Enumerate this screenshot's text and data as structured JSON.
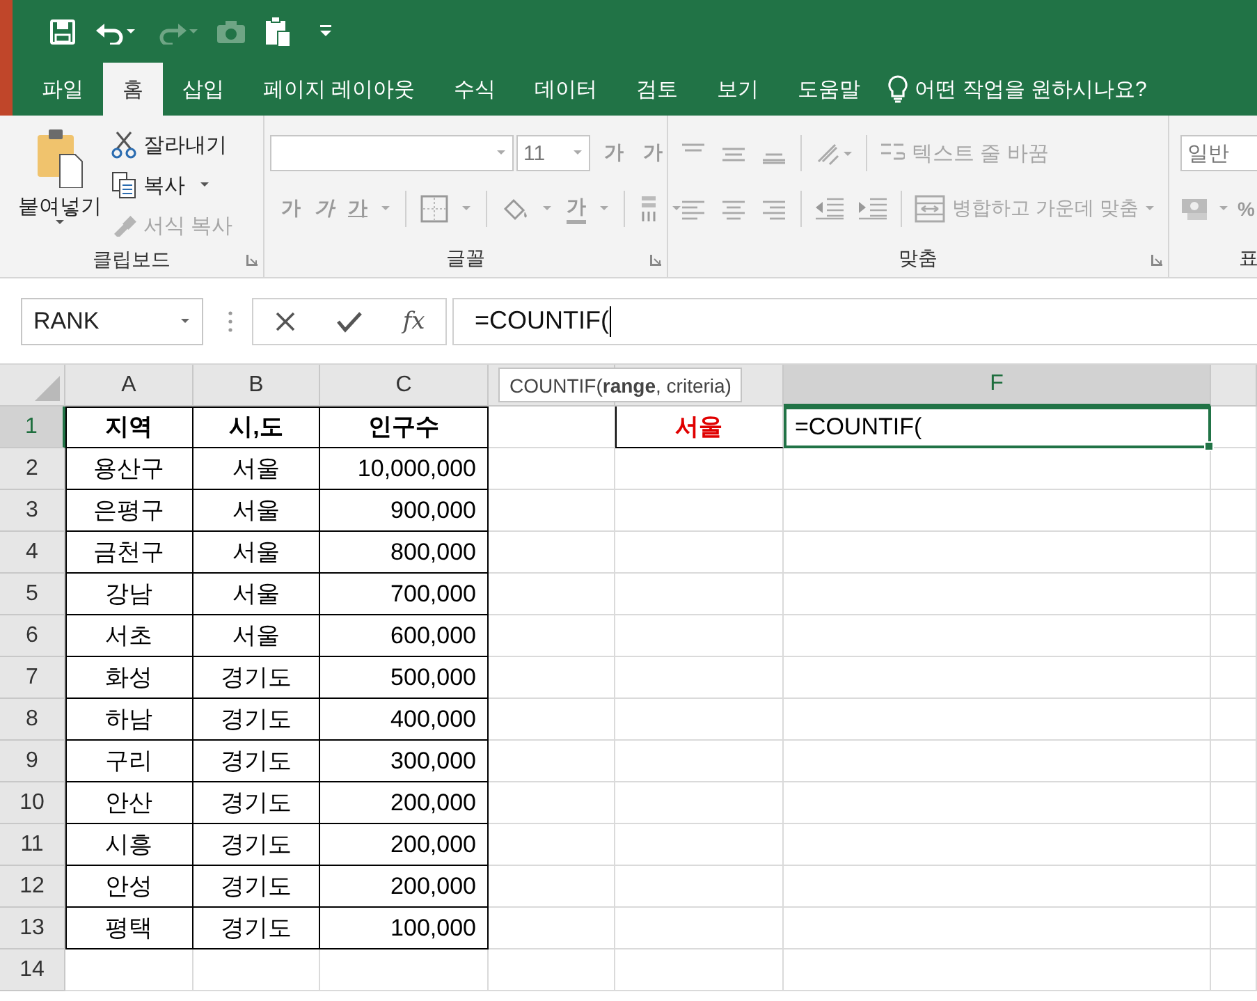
{
  "quick_access": [
    {
      "kind": "save",
      "disabled": false
    },
    {
      "kind": "undo",
      "disabled": false
    },
    {
      "kind": "redo",
      "disabled": true
    },
    {
      "kind": "camera",
      "disabled": true
    },
    {
      "kind": "paste",
      "disabled": false
    },
    {
      "kind": "customize",
      "disabled": false
    }
  ],
  "tabs": [
    {
      "label": "파일",
      "selected": false
    },
    {
      "label": "홈",
      "selected": true
    },
    {
      "label": "삽입",
      "selected": false
    },
    {
      "label": "페이지 레이아웃",
      "selected": false
    },
    {
      "label": "수식",
      "selected": false
    },
    {
      "label": "데이터",
      "selected": false
    },
    {
      "label": "검토",
      "selected": false
    },
    {
      "label": "보기",
      "selected": false
    },
    {
      "label": "도움말",
      "selected": false
    }
  ],
  "tell_me": "어떤 작업을 원하시나요?",
  "ribbon": {
    "clipboard": {
      "title": "클립보드",
      "paste": "붙여넣기",
      "commands": [
        {
          "kind": "cut",
          "label": "잘라내기",
          "disabled": false
        },
        {
          "kind": "copy",
          "label": "복사",
          "disabled": false
        },
        {
          "kind": "format_painter",
          "label": "서식 복사",
          "disabled": true
        }
      ]
    },
    "font": {
      "title": "글꼴",
      "size": "11",
      "grow": "가",
      "shrink": "가",
      "styles": [
        {
          "kind": "bold",
          "label": "가"
        },
        {
          "kind": "italic",
          "label": "가"
        },
        {
          "kind": "underline",
          "label": "가"
        }
      ],
      "font_color": "가"
    },
    "alignment": {
      "title": "맞춤",
      "wrap": {
        "label": "텍스트 줄 바꿈",
        "disabled": true
      },
      "merge": {
        "label": "병합하고 가운데 맞춤",
        "disabled": true
      }
    },
    "number": {
      "format": "일반",
      "percent": "%",
      "title": "표"
    }
  },
  "formula_bar": {
    "name_box": "RANK",
    "fx": "fx",
    "formula": "=COUNTIF("
  },
  "sheet": {
    "columns": [
      {
        "label": "A",
        "selected": false
      },
      {
        "label": "B",
        "selected": false
      },
      {
        "label": "C",
        "selected": false
      },
      {
        "label": "F",
        "selected": true
      }
    ],
    "tooltip": "COUNTIF(**range**, criteria)",
    "rows": [
      {
        "number": "1",
        "selected": true,
        "cells": [
          "지역",
          "시,도",
          "인구수"
        ],
        "e_cell": "서울",
        "f_cell": "=COUNTIF("
      },
      {
        "number": "2",
        "selected": false,
        "cells": [
          "용산구",
          "서울",
          "10,000,000"
        ]
      },
      {
        "number": "3",
        "selected": false,
        "cells": [
          "은평구",
          "서울",
          "900,000"
        ]
      },
      {
        "number": "4",
        "selected": false,
        "cells": [
          "금천구",
          "서울",
          "800,000"
        ]
      },
      {
        "number": "5",
        "selected": false,
        "cells": [
          "강남",
          "서울",
          "700,000"
        ]
      },
      {
        "number": "6",
        "selected": false,
        "cells": [
          "서초",
          "서울",
          "600,000"
        ]
      },
      {
        "number": "7",
        "selected": false,
        "cells": [
          "화성",
          "경기도",
          "500,000"
        ]
      },
      {
        "number": "8",
        "selected": false,
        "cells": [
          "하남",
          "경기도",
          "400,000"
        ]
      },
      {
        "number": "9",
        "selected": false,
        "cells": [
          "구리",
          "경기도",
          "300,000"
        ]
      },
      {
        "number": "10",
        "selected": false,
        "cells": [
          "안산",
          "경기도",
          "200,000"
        ]
      },
      {
        "number": "11",
        "selected": false,
        "cells": [
          "시흥",
          "경기도",
          "200,000"
        ]
      },
      {
        "number": "12",
        "selected": false,
        "cells": [
          "안성",
          "경기도",
          "200,000"
        ]
      },
      {
        "number": "13",
        "selected": false,
        "cells": [
          "평택",
          "경기도",
          "100,000"
        ]
      },
      {
        "number": "14",
        "selected": false
      }
    ]
  }
}
